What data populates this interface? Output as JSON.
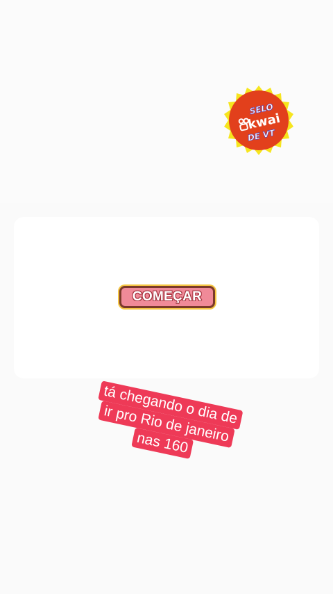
{
  "badge": {
    "line1": "SELO",
    "brand": "kwai",
    "line3": "DE VT",
    "colors": {
      "fill": "#e2401c",
      "ring": "#f6e51e",
      "text": "#ffffff",
      "text_outline": "#5b3fb0"
    }
  },
  "main": {
    "start_button_label": "COMEÇAR"
  },
  "caption": {
    "lines": [
      "tá chegando o dia de",
      "ir pro Rio de janeiro",
      "nas 160"
    ],
    "background": "#ee3a57"
  },
  "colors": {
    "page": "#fafafa",
    "card": "#ffffff",
    "button_fill": "#f08a98",
    "button_border": "#7a3a2a"
  }
}
